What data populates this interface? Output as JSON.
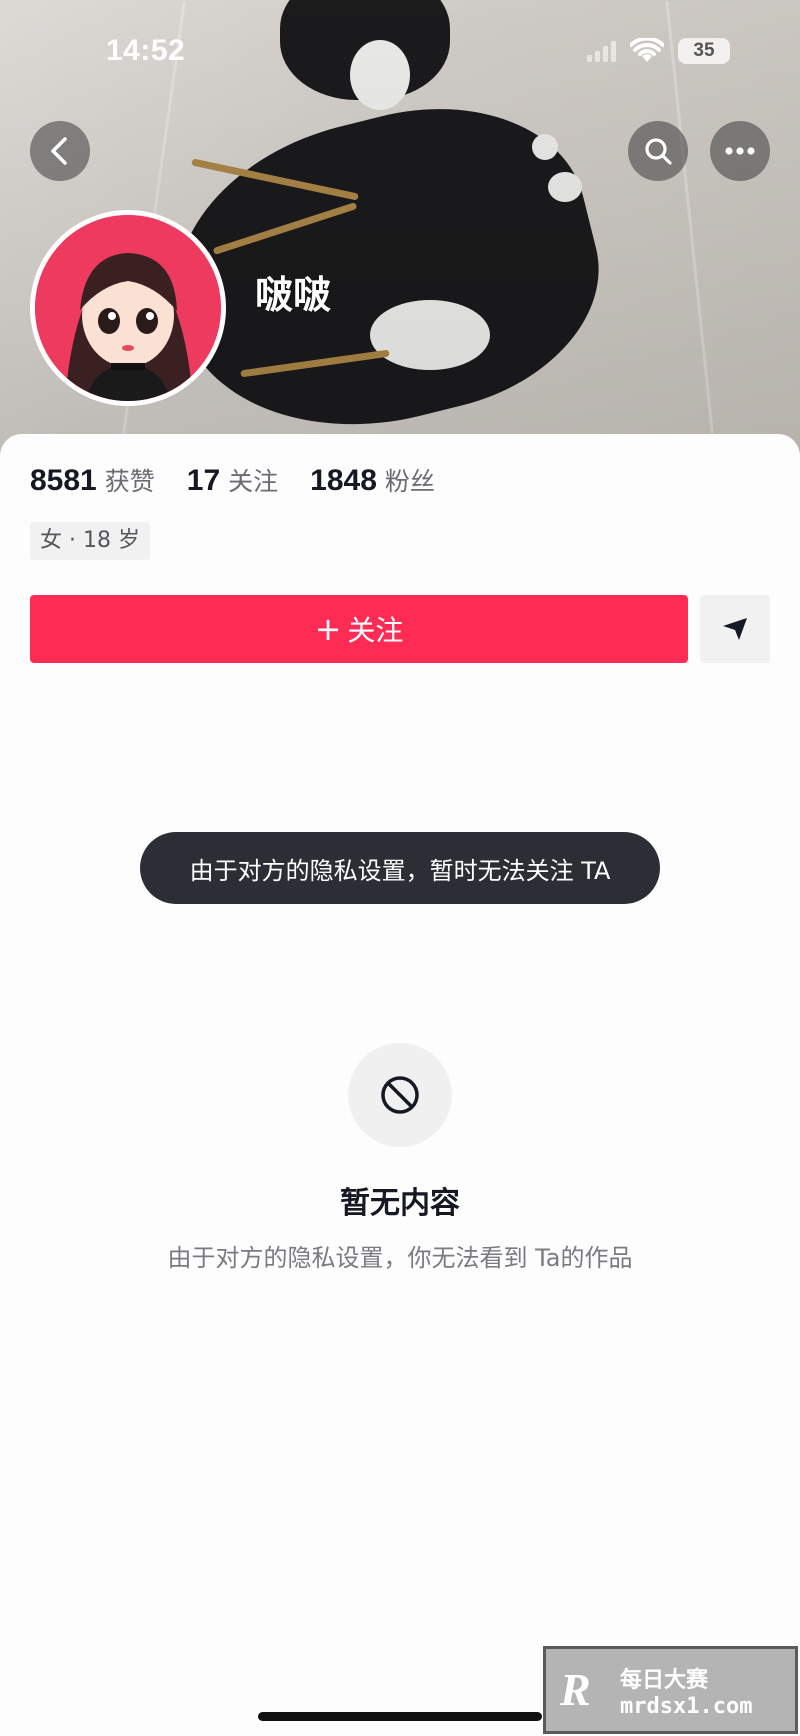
{
  "status_bar": {
    "time": "14:52",
    "battery": "35"
  },
  "header": {
    "back_icon": "chevron-left-icon",
    "search_icon": "search-icon",
    "more_icon": "more-dots-icon"
  },
  "profile": {
    "username": "啵啵",
    "tag": "女 · 18 岁",
    "stats": [
      {
        "value": "8581",
        "label": "获赞"
      },
      {
        "value": "17",
        "label": "关注"
      },
      {
        "value": "1848",
        "label": "粉丝"
      }
    ]
  },
  "actions": {
    "follow_plus": "+",
    "follow_label": "关注",
    "share_icon": "send-icon"
  },
  "toast": "由于对方的隐私设置，暂时无法关注 TA",
  "empty_state": {
    "icon": "forbidden-icon",
    "title": "暂无内容",
    "subtitle": "由于对方的隐私设置，你无法看到 Ta的作品"
  },
  "watermark": {
    "logo": "R",
    "name": "每日大赛",
    "url": "mrdsx1.com"
  },
  "colors": {
    "accent": "#fe2c55",
    "toast_bg": "#2c2e36",
    "avatar_bg": "#ee3a5e"
  }
}
